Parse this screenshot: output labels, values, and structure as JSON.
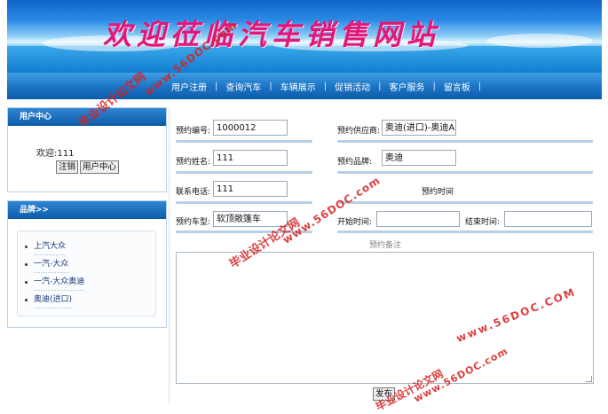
{
  "banner": {
    "title": "欢迎莅临汽车销售网站"
  },
  "nav": {
    "items": [
      "用户注册",
      "查询汽车",
      "车辆展示",
      "促销活动",
      "客户服务",
      "留言板"
    ]
  },
  "user_panel": {
    "heading": "用户中心",
    "welcome": "欢迎:111",
    "logout_label": "注销",
    "center_label": "用户中心"
  },
  "brand_panel": {
    "heading": "品牌>>",
    "items": [
      "上汽大众",
      "一汽-大众",
      "一汽-大众奥迪",
      "奥迪(进口)"
    ]
  },
  "form": {
    "booking_no_label": "预约编号:",
    "booking_no": "1000012",
    "supplier_label": "预约供应商:",
    "supplier": "奥迪(进口)-奥迪A",
    "name_label": "预约姓名:",
    "name": "111",
    "brand_label": "预约品牌:",
    "brand": "奥迪",
    "phone_label": "联系电话:",
    "phone": "111",
    "time_caption": "预约时间",
    "model_label": "预约车型:",
    "model": "软顶敞篷车",
    "start_label": "开始时间:",
    "start": "",
    "end_label": "结束时间:",
    "end": "",
    "remark_caption": "预约备注",
    "submit_label": "发布"
  },
  "watermark": {
    "cn": "毕业设计论文网",
    "url": "www.56DOC.com",
    "url2": "www.56DOC.COM"
  }
}
